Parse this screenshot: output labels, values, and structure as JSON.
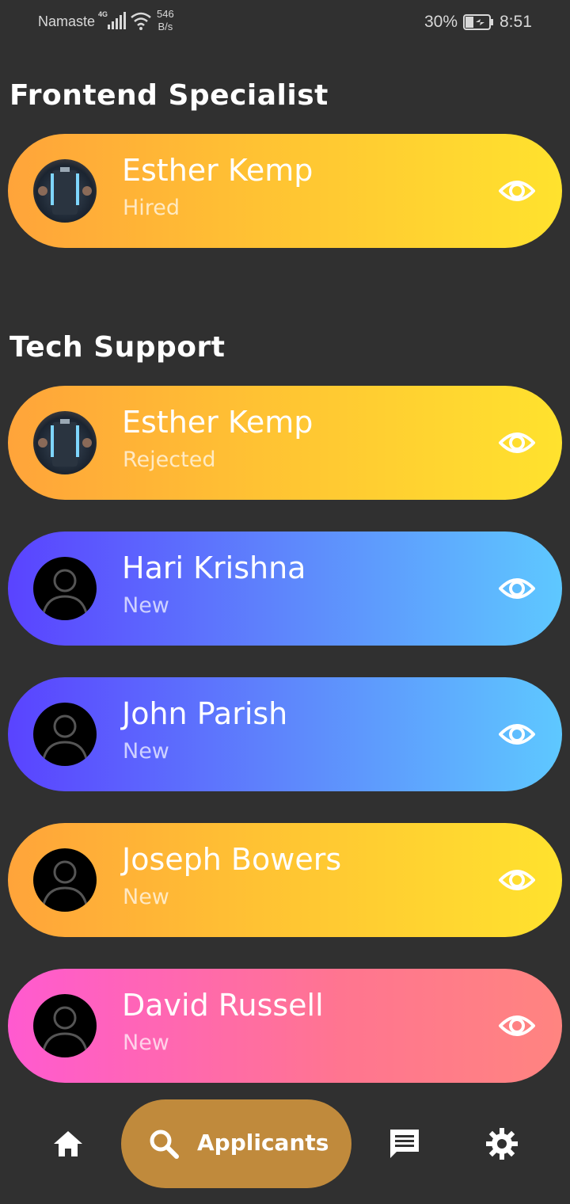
{
  "status_bar": {
    "carrier": "Namaste",
    "network": "4G",
    "speed_value": "546",
    "speed_unit": "B/s",
    "battery_percent": "30%",
    "time": "8:51"
  },
  "sections": [
    {
      "title": "Frontend Specialist",
      "applicants": [
        {
          "name": "Esther Kemp",
          "status": "Hired",
          "avatar": "photo-avatar",
          "theme": "orange"
        }
      ]
    },
    {
      "title": "Tech Support",
      "applicants": [
        {
          "name": "Esther Kemp",
          "status": "Rejected",
          "avatar": "photo-avatar",
          "theme": "orange"
        },
        {
          "name": "Hari Krishna",
          "status": "New",
          "avatar": "default-person-icon",
          "theme": "blue"
        },
        {
          "name": "John Parish",
          "status": "New",
          "avatar": "default-person-icon",
          "theme": "blue"
        },
        {
          "name": "Joseph Bowers",
          "status": "New",
          "avatar": "default-person-icon",
          "theme": "orange"
        },
        {
          "name": "David Russell",
          "status": "New",
          "avatar": "default-person-icon",
          "theme": "pink"
        }
      ]
    }
  ],
  "bottom_nav": {
    "home_icon": "home-icon",
    "active_label": "Applicants",
    "active_icon": "search-icon",
    "messages_icon": "chat-icon",
    "settings_icon": "gear-icon",
    "active_color": "#c08a3c"
  },
  "colors": {
    "background": "#303030",
    "orange_gradient": [
      "#ffa43a",
      "#ffe22e"
    ],
    "blue_gradient": [
      "#5a43ff",
      "#5ec8ff"
    ],
    "pink_gradient": [
      "#ff5ad0",
      "#ff8480"
    ]
  }
}
